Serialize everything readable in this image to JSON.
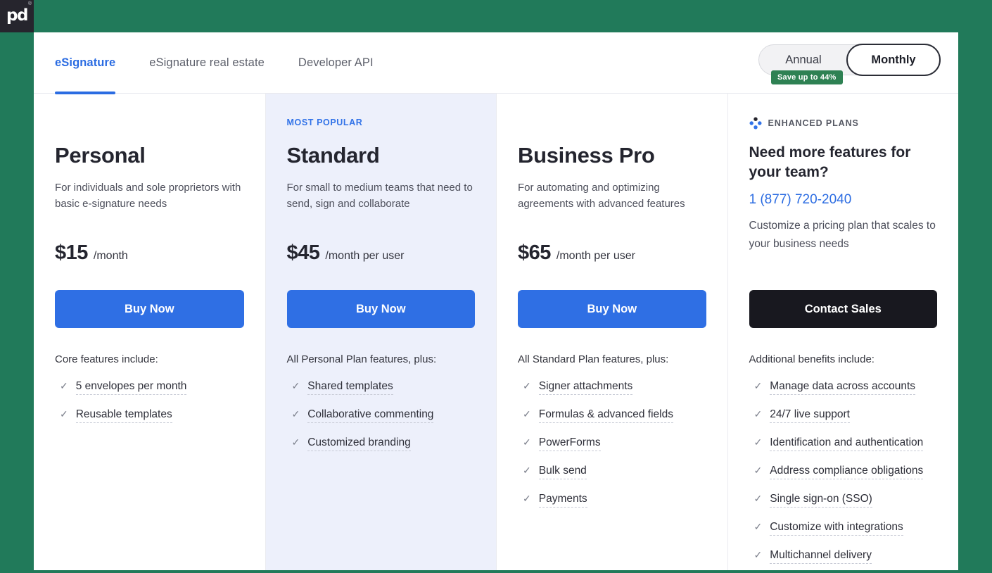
{
  "brand": {
    "logo_text": "pd",
    "registered_mark": "®"
  },
  "icons": {
    "check": "✓"
  },
  "colors": {
    "background_green": "#217a5a",
    "accent_blue": "#2f6fe4",
    "dark_button": "#18181f",
    "badge_green": "#2e8153",
    "standard_column_bg": "#edf0fb",
    "logo_square": "#26252d"
  },
  "tabs": [
    {
      "label": "eSignature",
      "active": true
    },
    {
      "label": "eSignature real estate",
      "active": false
    },
    {
      "label": "Developer API",
      "active": false
    }
  ],
  "billing_toggle": {
    "options": [
      "Annual",
      "Monthly"
    ],
    "selected": "Monthly",
    "badge": "Save up to 44%"
  },
  "plans": [
    {
      "badge": "",
      "name": "Personal",
      "description": "For individuals and sole proprietors with basic e-signature needs",
      "price": "$15",
      "price_suffix": "/month",
      "cta": "Buy Now",
      "features_heading": "Core features include:",
      "features": [
        "5 envelopes per month",
        "Reusable templates"
      ]
    },
    {
      "badge": "MOST POPULAR",
      "name": "Standard",
      "description": "For small to medium teams that need to send, sign and collaborate",
      "price": "$45",
      "price_suffix": "/month per user",
      "cta": "Buy Now",
      "features_heading": "All Personal Plan features, plus:",
      "features": [
        "Shared templates",
        "Collaborative commenting",
        "Customized branding"
      ]
    },
    {
      "badge": "",
      "name": "Business Pro",
      "description": "For automating and optimizing agreements with advanced features",
      "price": "$65",
      "price_suffix": "/month per user",
      "cta": "Buy Now",
      "features_heading": "All Standard Plan features, plus:",
      "features": [
        "Signer attachments",
        "Formulas & advanced fields",
        "PowerForms",
        "Bulk send",
        "Payments"
      ]
    }
  ],
  "enhanced": {
    "label": "ENHANCED PLANS",
    "title": "Need more features for your team?",
    "phone": "1 (877) 720-2040",
    "description": "Customize a pricing plan that scales to your business needs",
    "cta": "Contact Sales",
    "features_heading": "Additional benefits include:",
    "features": [
      "Manage data across accounts",
      "24/7 live support",
      "Identification and authentication",
      "Address compliance obligations",
      "Single sign-on (SSO)",
      "Customize with integrations",
      "Multichannel delivery"
    ]
  }
}
